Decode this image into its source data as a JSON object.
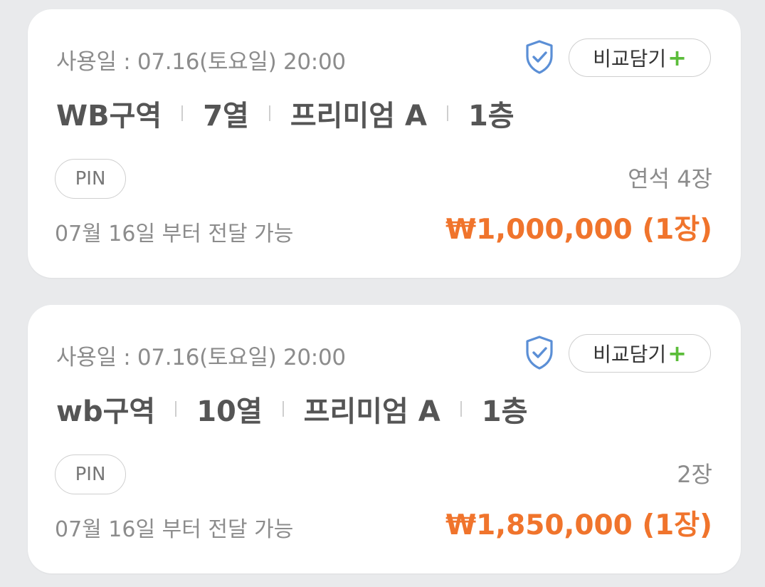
{
  "listings": [
    {
      "use_date": "사용일 : 07.16(토요일) 20:00",
      "compare_label": "비교담기",
      "compare_plus": "+",
      "section": "WB구역",
      "row": "7열",
      "grade": "프리미엄 A",
      "floor": "1층",
      "pin_label": "PIN",
      "quantity": "연석 4장",
      "delivery": "07월 16일 부터 전달 가능",
      "price": "₩1,000,000 (1장)"
    },
    {
      "use_date": "사용일 : 07.16(토요일) 20:00",
      "compare_label": "비교담기",
      "compare_plus": "+",
      "section": "wb구역",
      "row": "10열",
      "grade": "프리미엄 A",
      "floor": "1층",
      "pin_label": "PIN",
      "quantity": "2장",
      "delivery": "07월 16일 부터 전달 가능",
      "price": "₩1,850,000 (1장)"
    }
  ],
  "colors": {
    "price": "#f0742c",
    "plus": "#5bbd3a",
    "shield": "#5b8fd6",
    "background": "#e9eaec"
  },
  "icons": {
    "verified": "shield-check-icon",
    "add": "plus-icon"
  }
}
